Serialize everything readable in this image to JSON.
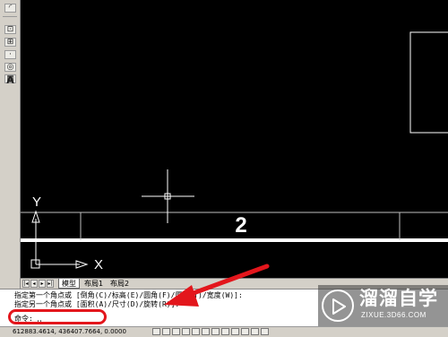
{
  "left_toolbar": {
    "text_tool_label": "A"
  },
  "canvas": {
    "number_label": "2",
    "ucs_y_label": "Y",
    "ucs_x_label": "X",
    "colors": {
      "background": "#000000",
      "lines": "#ffffff",
      "lines_dim": "#bfbfbf"
    }
  },
  "layout_tabs": {
    "tabs": [
      {
        "label": "模型",
        "active": true
      },
      {
        "label": "布局1",
        "active": false
      },
      {
        "label": "布局2",
        "active": false
      }
    ]
  },
  "command": {
    "history": [
      "指定第一个角点或 [倒角(C)/标高(E)/圆角(F)/厚度(T)/宽度(W)]:",
      "指定另一个角点或 [面积(A)/尺寸(D)/旋转(R)]:"
    ],
    "prompt": "命令: ␣"
  },
  "status_bar": {
    "coordinates": "612883.4614,  436407.7664,  0.0000"
  },
  "watermark": {
    "title": "溜溜自学",
    "subtitle": "ZIXUE.3D66.COM"
  },
  "annotation": {
    "highlight_color": "#e3161c"
  }
}
